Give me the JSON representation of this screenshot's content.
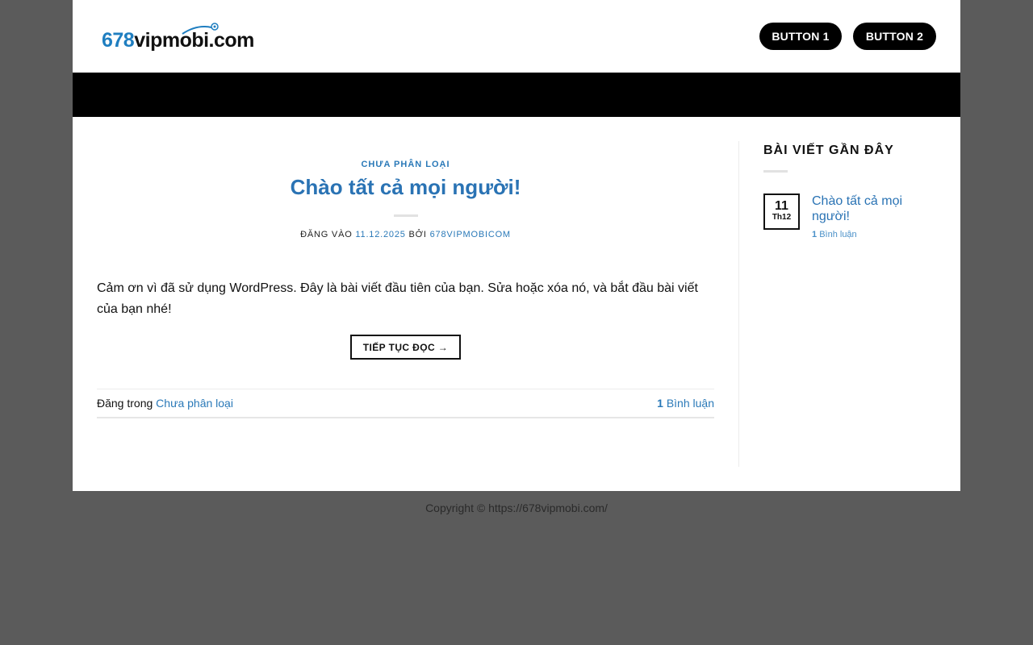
{
  "header": {
    "logo_number": "678",
    "logo_text": "vipmobi.com",
    "button_1": "BUTTON 1",
    "button_2": "BUTTON 2"
  },
  "post": {
    "category": "CHƯA PHÂN LOẠI",
    "title": "Chào tất cả mọi người!",
    "meta_prefix": "ĐĂNG VÀO",
    "meta_date": "11.12.2025",
    "meta_by": "BỞI",
    "meta_author": "678VIPMOBICOM",
    "excerpt": "Cảm ơn vì đã sử dụng WordPress. Đây là bài viết đầu tiên của bạn. Sửa hoặc xóa nó, và bắt đầu bài viết của bạn nhé!",
    "read_more": "TIẾP TỤC ĐỌC →",
    "footer_posted_in": "Đăng trong",
    "footer_category": "Chưa phân loại",
    "footer_comment_count": "1",
    "footer_comment_label": "Bình luận"
  },
  "sidebar": {
    "widget_title": "BÀI VIẾT GẦN ĐÂY",
    "recent": {
      "day": "11",
      "month": "Th12",
      "title": "Chào tất cả mọi người!",
      "comment_count": "1",
      "comment_label": "Bình luận"
    }
  },
  "footer": {
    "copyright": "Copyright © https://678vipmobi.com/"
  },
  "colors": {
    "link": "#2a73b4",
    "background": "#5b5b5b",
    "button": "#000000"
  }
}
